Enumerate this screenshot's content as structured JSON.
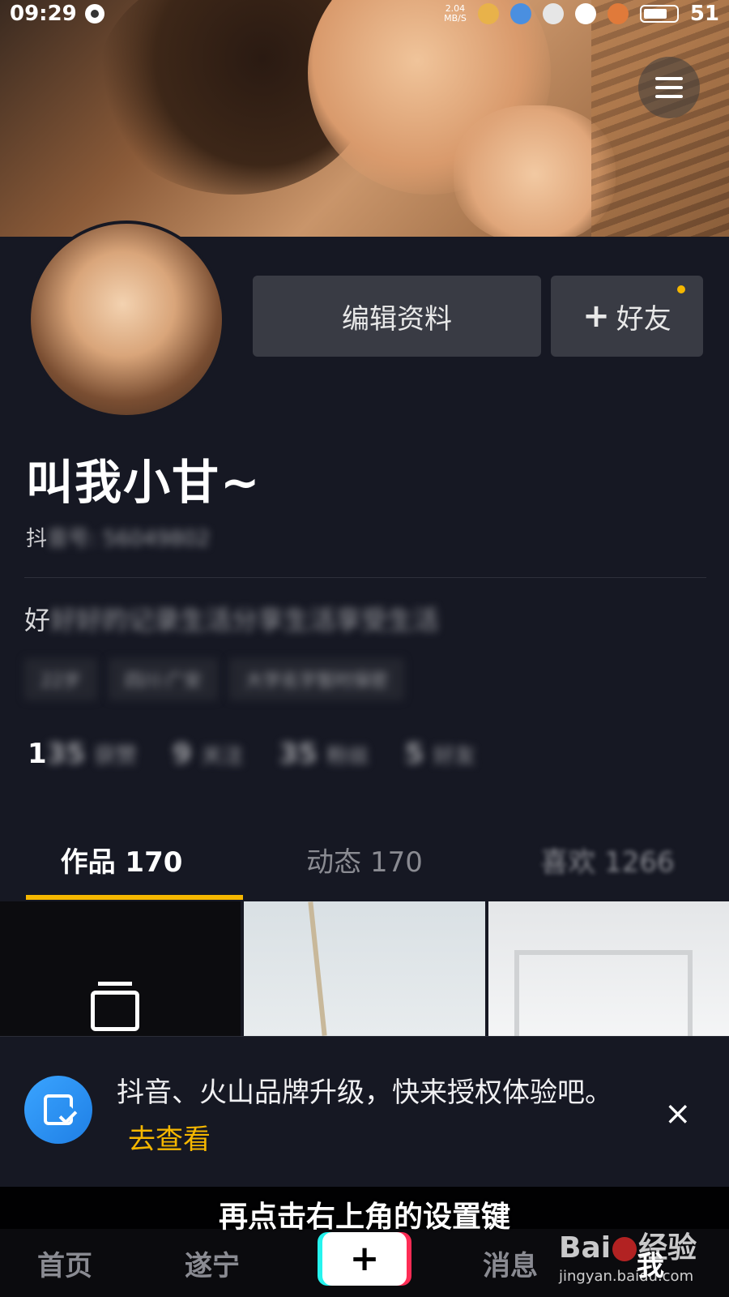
{
  "status_bar": {
    "time": "09:29",
    "net_speed_value": "2.04",
    "net_speed_unit": "MB/S",
    "battery_level": "51"
  },
  "profile": {
    "nickname": "叫我小甘~",
    "douyin_id_prefix": "抖",
    "douyin_id_blurred": "音号: 56049802",
    "bio_first_char": "好",
    "bio_blurred": "好好的记录生活分享生活享受生活",
    "tags": [
      "22岁",
      "四川·广安",
      "大学名字暂时保密"
    ],
    "edit_button": "编辑资料",
    "add_friend_button": "好友",
    "add_friend_plus": "+"
  },
  "stats": [
    {
      "number_visible": "1",
      "number_blurred": "35",
      "label_blurred": "获赞"
    },
    {
      "number_visible": "",
      "number_blurred": "9",
      "label_blurred": "关注"
    },
    {
      "number_visible": "",
      "number_blurred": "35",
      "label_blurred": "粉丝"
    },
    {
      "number_visible": "",
      "number_blurred": "5",
      "label_blurred": "好友"
    }
  ],
  "tabs": [
    {
      "label": "作品 170",
      "active": true
    },
    {
      "label": "动态 170",
      "active": false
    },
    {
      "label": "喜欢 1266",
      "active": false
    }
  ],
  "notice": {
    "text": "抖音、火山品牌升级，快来授权体验吧。",
    "link": "去查看",
    "close": "×"
  },
  "subtitle": "再点击右上角的设置键",
  "bottom_nav": {
    "home": "首页",
    "city": "遂宁",
    "publish": "+",
    "messages": "消息",
    "me": "我"
  },
  "watermark": {
    "logo": "Bai 百度 经验",
    "logo_left": "Bai",
    "logo_right": "经验",
    "url": "jingyan.baidu.com"
  },
  "colors": {
    "background": "#161823",
    "accent": "#f5b700",
    "button": "#393b44"
  }
}
